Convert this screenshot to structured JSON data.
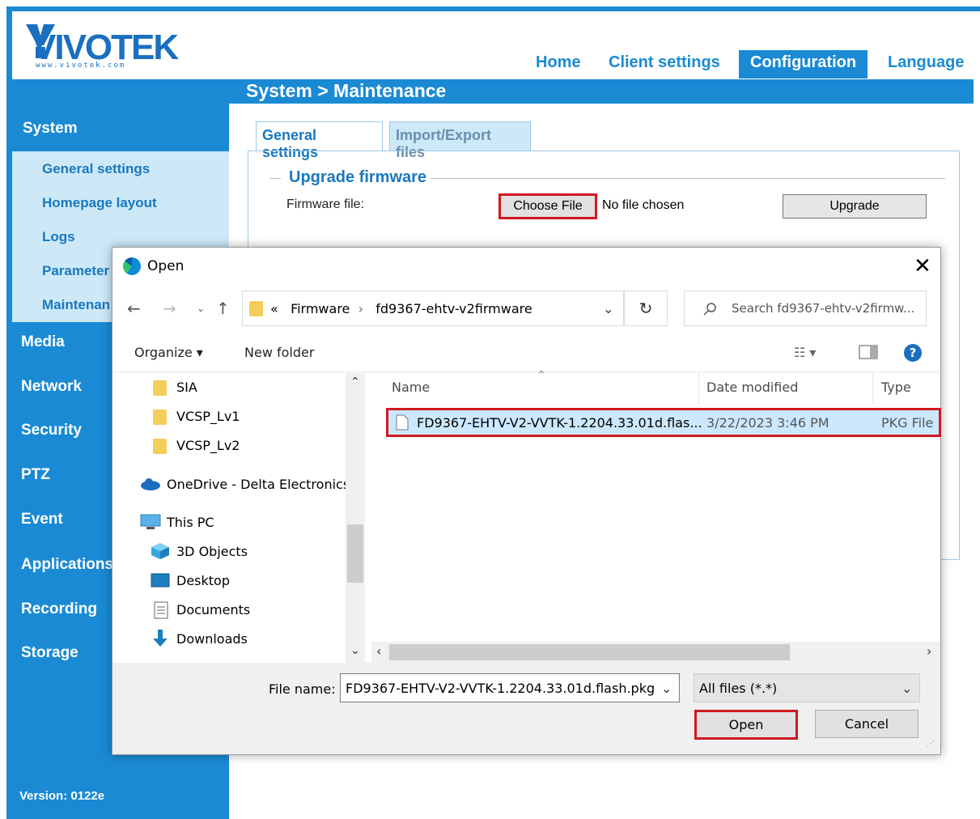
{
  "brand": {
    "name": "VIVOTEK",
    "url": "www.vivotek.com"
  },
  "topnav": {
    "home": "Home",
    "client_settings": "Client settings",
    "configuration": "Configuration",
    "language": "Language"
  },
  "breadcrumb": "System  > Maintenance",
  "sidebar": {
    "system": "System",
    "sub_items": [
      "General settings",
      "Homepage layout",
      "Logs",
      "Parameter",
      "Maintenan"
    ],
    "sections": [
      "Media",
      "Network",
      "Security",
      "PTZ",
      "Event",
      "Applications",
      "Recording",
      "Storage"
    ],
    "version": "Version: 0122e"
  },
  "tabs": [
    "General settings",
    "Import/Export files"
  ],
  "upgrade": {
    "legend": "Upgrade firmware",
    "firmware_label": "Firmware file:",
    "choose_file": "Choose File",
    "no_file": "No file chosen",
    "upgrade_button": "Upgrade"
  },
  "dialog": {
    "title": "Open",
    "close": "✕",
    "address": {
      "prefix": "«",
      "crumbs": [
        "Firmware",
        "fd9367-ehtv-v2firmware"
      ]
    },
    "search_placeholder": "Search fd9367-ehtv-v2firmw...",
    "organize": "Organize ▾",
    "new_folder": "New folder",
    "tree": [
      {
        "label": "SIA",
        "icon": "folder"
      },
      {
        "label": "VCSP_Lv1",
        "icon": "folder"
      },
      {
        "label": "VCSP_Lv2",
        "icon": "folder"
      },
      {
        "label": "OneDrive - Delta Electronics,",
        "icon": "cloud"
      },
      {
        "label": "This PC",
        "icon": "pc"
      },
      {
        "label": "3D Objects",
        "icon": "cube"
      },
      {
        "label": "Desktop",
        "icon": "desktop"
      },
      {
        "label": "Documents",
        "icon": "document"
      },
      {
        "label": "Downloads",
        "icon": "download-arrow"
      }
    ],
    "columns": {
      "name": "Name",
      "date_modified": "Date modified",
      "type": "Type"
    },
    "files": [
      {
        "name": "FD9367-EHTV-V2-VVTK-1.2204.33.01d.flas...",
        "date": "3/22/2023 3:46 PM",
        "type": "PKG File"
      }
    ],
    "file_name_label": "File name:",
    "file_name_value": "FD9367-EHTV-V2-VVTK-1.2204.33.01d.flash.pkg",
    "filter": "All files (*.*)",
    "open_button": "Open",
    "cancel_button": "Cancel"
  },
  "colors": {
    "primary_blue": "#1a8ad4",
    "submenu_bg": "#cde9f8",
    "highlight_red": "#d0191f",
    "selection_blue": "#cce8ff"
  }
}
